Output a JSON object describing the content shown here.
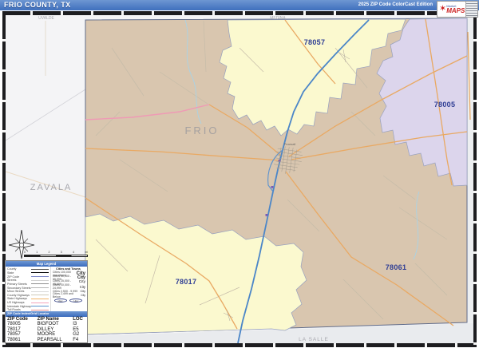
{
  "header": {
    "title": "FRIO COUNTY, TX",
    "edition": "2025 ZIP Code ColorCast Edition",
    "logo_small": "Market",
    "logo_big": "MAPS"
  },
  "map": {
    "county_label": "FRIO",
    "neighbor_labels": {
      "west": "ZAVALA",
      "northwest": "UVALDE",
      "north": "MEDINA",
      "south": "LA SALLE"
    },
    "zip_labels": {
      "moore": "78057",
      "bigfoot": "78005",
      "dilley": "78017",
      "pearsall": "78061"
    },
    "city_label": "Pearsall",
    "colors": {
      "zip_78061_fill": "#d9c6af",
      "zip_78057_fill": "#fbf9cf",
      "zip_78017_fill": "#fbf9cf",
      "zip_78005_fill": "#dcd5ec",
      "outside_fill": "#f4f4f6",
      "interstate": "#4b86c8",
      "us_highway": "#ef9ab5",
      "state_highway": "#e9a963",
      "zip_label_text": "#2e3d94",
      "titlebar_blue": "#3f6fbd"
    }
  },
  "scalebar": {
    "labels": [
      "0",
      "1",
      "2",
      "3",
      "4"
    ],
    "unit": "mi"
  },
  "legend": {
    "title": "Map Legend",
    "line_rows": [
      {
        "label": "County"
      },
      {
        "label": "State"
      },
      {
        "label": "ZIP Code"
      },
      {
        "label": "Streets"
      },
      {
        "label": "Primary Streets"
      },
      {
        "label": "Secondary Streets"
      },
      {
        "label": "Minor Streets"
      },
      {
        "label": "County Highways"
      },
      {
        "label": "State Highways"
      },
      {
        "label": "US Highways"
      },
      {
        "label": "Interstate Highways"
      },
      {
        "label": "Toll Roads"
      }
    ],
    "cities_header": "Cities and Towns",
    "city_rows": [
      {
        "label": "Cities 100,000 and Above",
        "sample": "City"
      },
      {
        "label": "Cities 50,000 - 99,999",
        "sample": "City"
      },
      {
        "label": "Cities 25,000 - 49,999",
        "sample": "City"
      },
      {
        "label": "Cities 10,000 - 24,999",
        "sample": "City"
      },
      {
        "label": "Cities 2,500 - 9,999",
        "sample": "City"
      },
      {
        "label": "Cities 2,499 and Below",
        "sample": "City"
      }
    ],
    "shield_label": "Hwy",
    "index_header": "ZIP Code Index/Grid Locator",
    "table": {
      "headers": [
        "ZIP Code",
        "ZIP Name",
        "LOC"
      ],
      "rows": [
        [
          "78005",
          "BIGFOOT",
          "I3"
        ],
        [
          "78017",
          "DILLEY",
          "E5"
        ],
        [
          "78057",
          "MOORE",
          "G2"
        ],
        [
          "78061",
          "PEARSALL",
          "F4"
        ]
      ]
    }
  }
}
